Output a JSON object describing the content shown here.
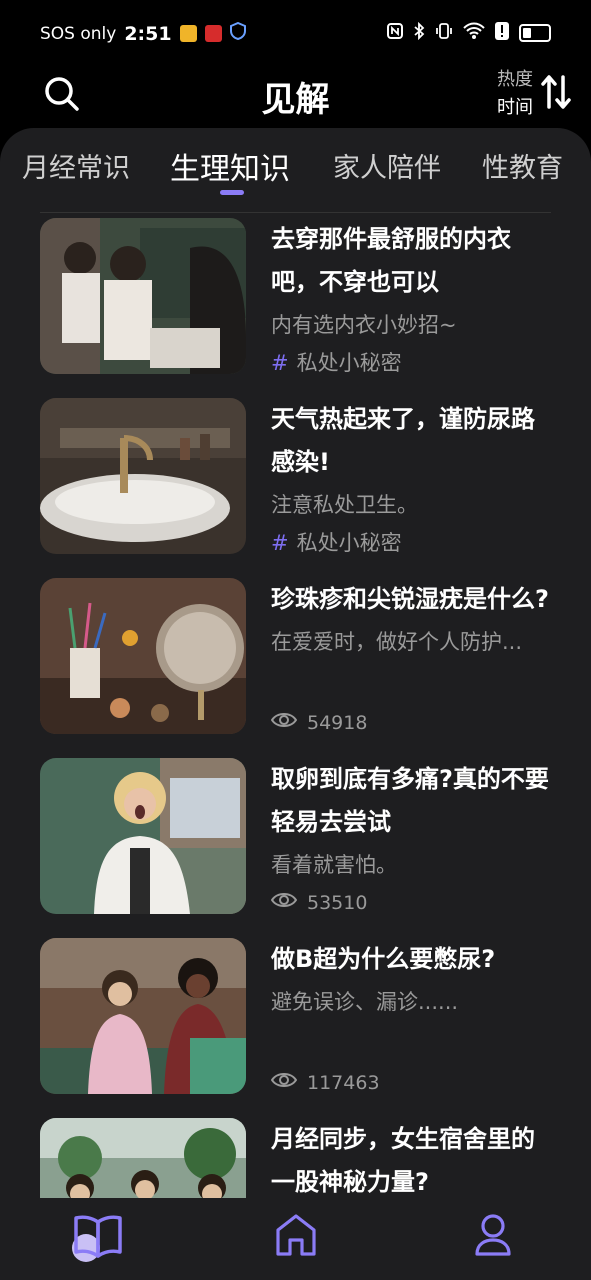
{
  "status_bar": {
    "carrier": "SOS only",
    "time": "2:51",
    "battery_level": 0.35
  },
  "header": {
    "title": "见解",
    "sort_primary": "热度",
    "sort_secondary": "时间"
  },
  "tabs": [
    {
      "label": "月经常识",
      "active": false
    },
    {
      "label": "生理知识",
      "active": true
    },
    {
      "label": "家人陪伴",
      "active": false
    },
    {
      "label": "性教育",
      "active": false
    }
  ],
  "articles": [
    {
      "title": "去穿那件最舒服的内衣吧，不穿也可以",
      "subtitle": "内有选内衣小妙招~",
      "tag": "私处小秘密",
      "views": ""
    },
    {
      "title": "天气热起来了，谨防尿路感染!",
      "subtitle": "注意私处卫生。",
      "tag": "私处小秘密",
      "views": ""
    },
    {
      "title": "珍珠疹和尖锐湿疣是什么?",
      "subtitle": "在爱爱时，做好个人防护...",
      "tag": "",
      "views": "54918"
    },
    {
      "title": "取卵到底有多痛?真的不要轻易去尝试",
      "subtitle": "看着就害怕。",
      "tag": "",
      "views": "53510"
    },
    {
      "title": "做B超为什么要憋尿?",
      "subtitle": "避免误诊、漏诊......",
      "tag": "",
      "views": "117463"
    },
    {
      "title": "月经同步，女生宿舍里的一股神秘力量?",
      "subtitle": "",
      "tag": "",
      "views": ""
    }
  ],
  "bottom_nav": [
    {
      "icon": "book-icon",
      "active": true
    },
    {
      "icon": "home-icon",
      "active": false
    },
    {
      "icon": "profile-icon",
      "active": false
    }
  ],
  "colors": {
    "accent": "#8b7cf6",
    "panel": "#1e1e20",
    "subtext": "#9a9a9a"
  }
}
